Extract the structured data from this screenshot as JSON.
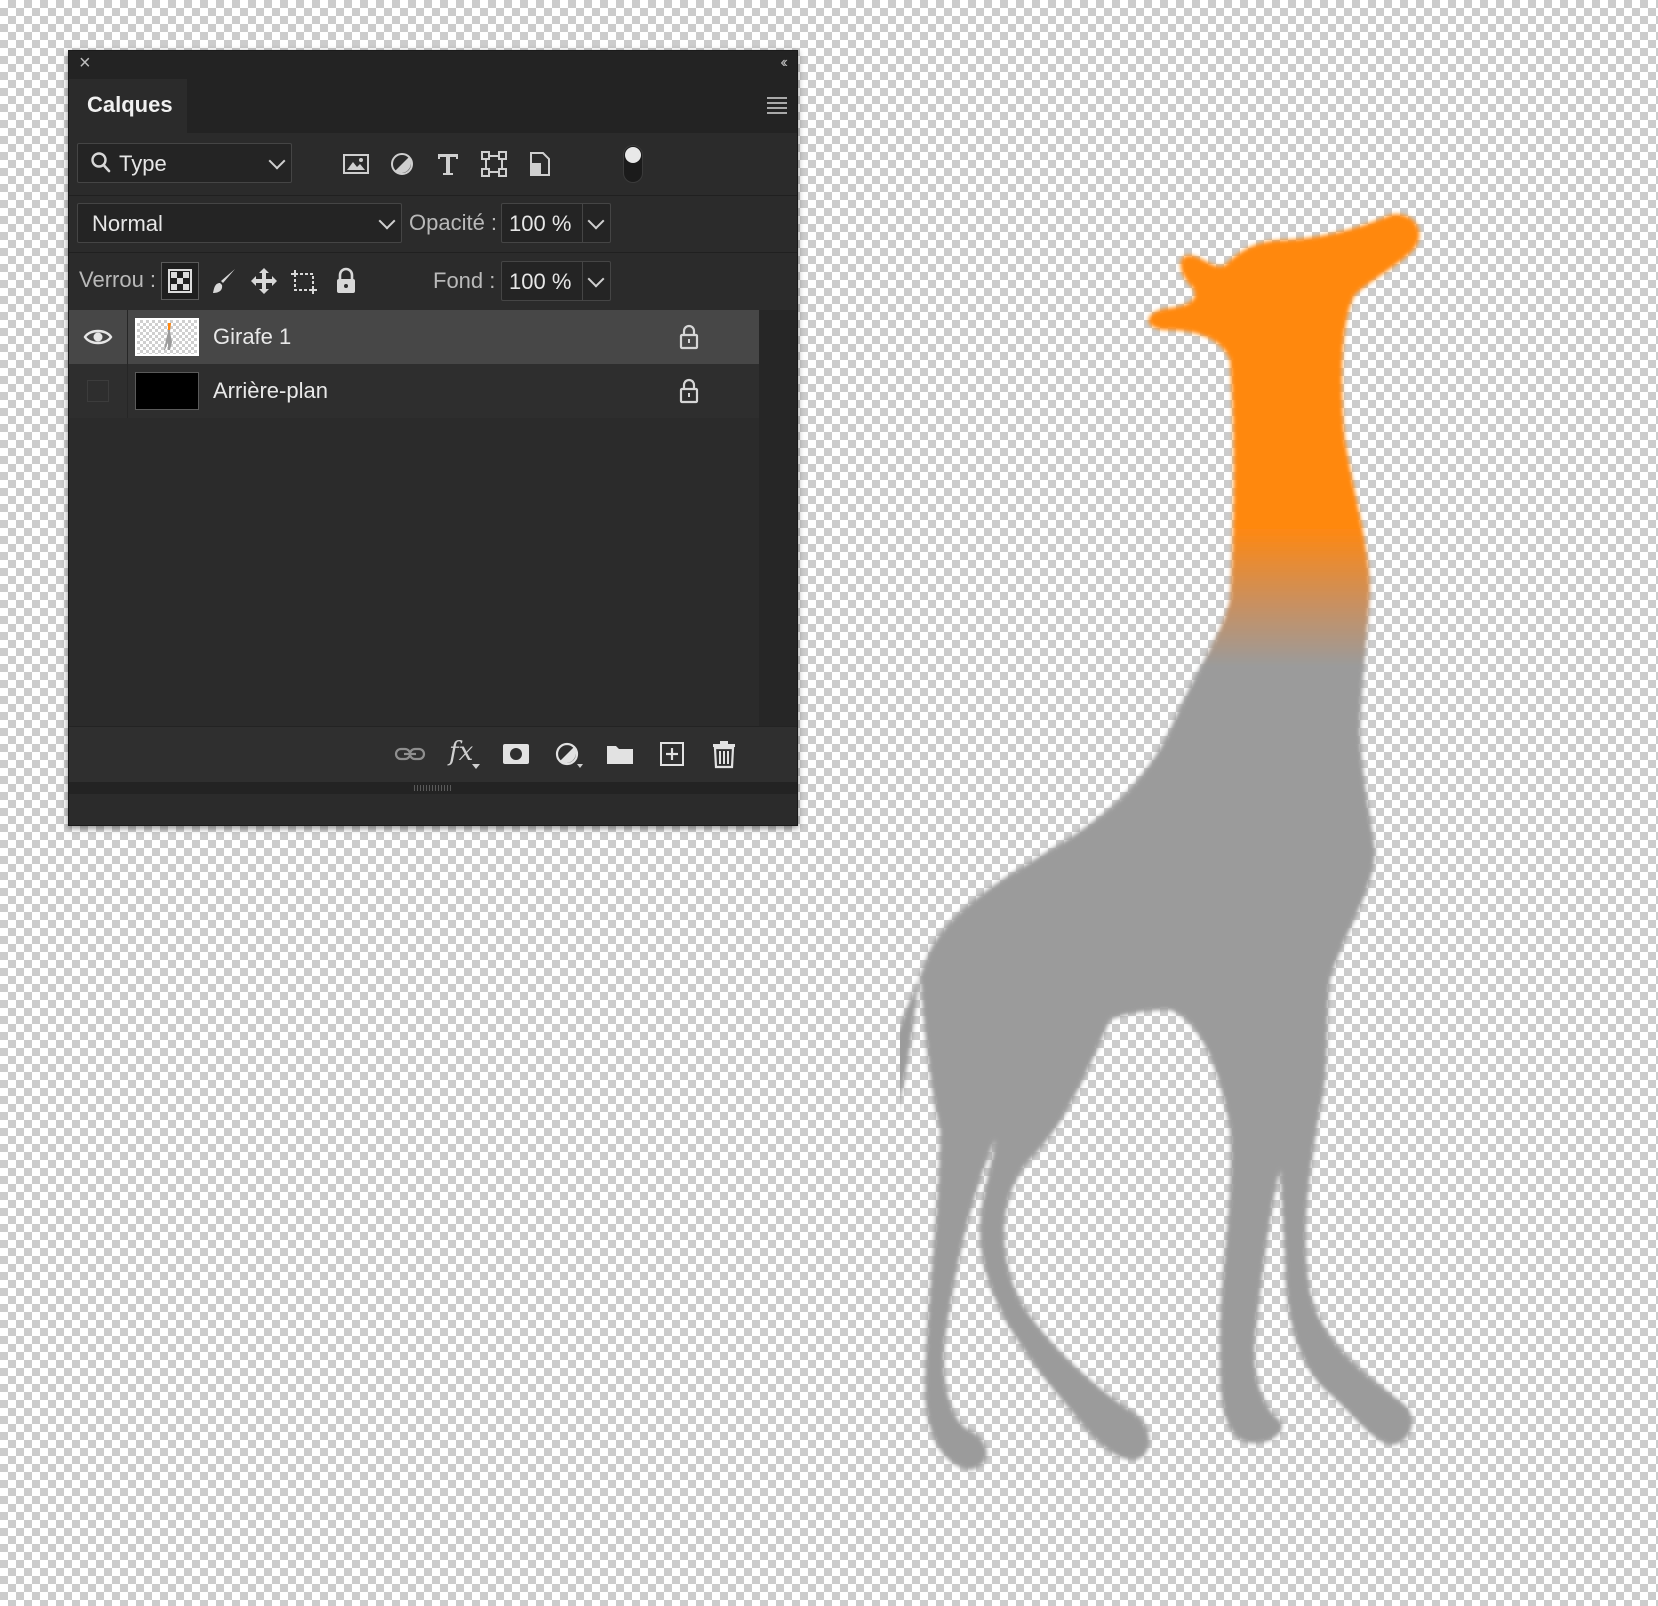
{
  "panel": {
    "tab_label": "Calques",
    "filter": {
      "selected": "Type"
    },
    "filter_icons": [
      "image-filter-icon",
      "adjustment-filter-icon",
      "type-filter-icon",
      "shape-filter-icon",
      "smart-object-filter-icon"
    ],
    "blend_mode": "Normal",
    "opacity_label": "Opacité :",
    "opacity_value": "100 %",
    "lock_label": "Verrou :",
    "fill_label": "Fond :",
    "fill_value": "100 %"
  },
  "layers": [
    {
      "name": "Girafe 1",
      "visible": true,
      "selected": true,
      "locked": true
    },
    {
      "name": "Arrière-plan",
      "visible": false,
      "selected": false,
      "locked": true
    }
  ],
  "bottom_bar": {
    "fx_label": "fx",
    "icons": [
      "link-layers-icon",
      "fx-icon",
      "add-mask-icon",
      "new-adjustment-icon",
      "new-group-icon",
      "new-layer-icon",
      "delete-layer-icon"
    ]
  },
  "colors": {
    "panel_bg": "#2b2b2b",
    "selected_layer": "#474747",
    "giraffe_head": "#ff8811",
    "giraffe_body": "#9b9b9b"
  }
}
